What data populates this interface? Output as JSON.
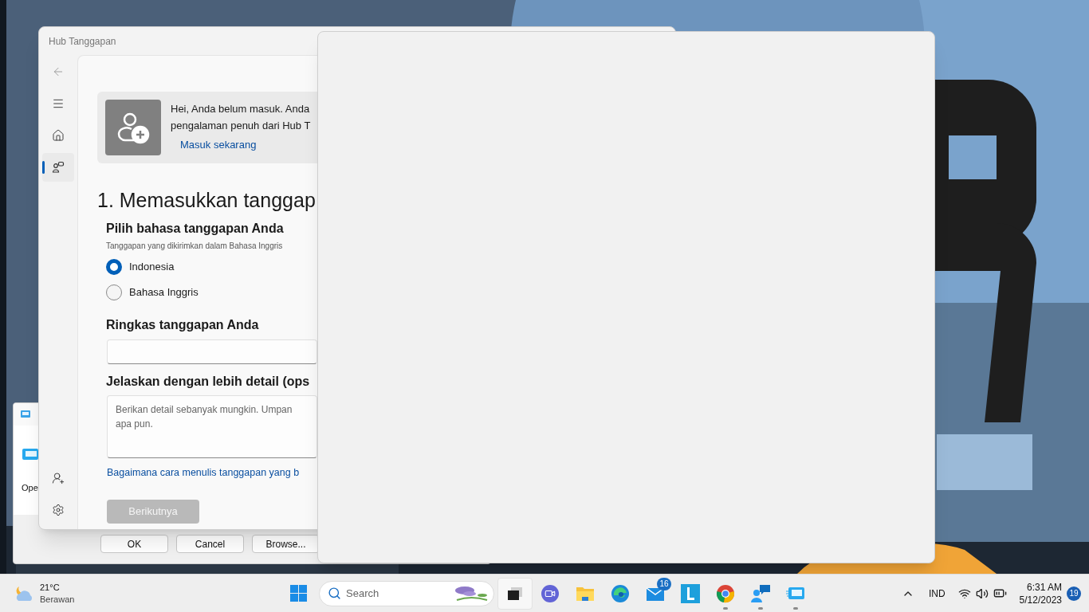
{
  "back_dialog": {
    "open_label": "Ope",
    "buttons": [
      "OK",
      "Cancel",
      "Browse..."
    ]
  },
  "feedback_window": {
    "title": "Hub Tanggapan",
    "nav_top": [
      {
        "kind": "back",
        "selected": false
      },
      {
        "kind": "menu",
        "selected": false
      },
      {
        "kind": "home",
        "selected": false
      },
      {
        "kind": "feedback",
        "selected": true
      }
    ],
    "nav_bottom": [
      {
        "kind": "add-user",
        "selected": false
      },
      {
        "kind": "settings",
        "selected": false
      }
    ],
    "sign_in_banner": {
      "lines": [
        "Hei, Anda belum masuk. Anda",
        "pengalaman penuh dari Hub T"
      ],
      "link": "Masuk sekarang"
    },
    "heading": "1. Memasukkan tanggap",
    "language": {
      "label": "Pilih bahasa tanggapan Anda",
      "note": "Tanggapan yang dikirimkan dalam Bahasa Inggris",
      "options": [
        {
          "label": "Indonesia",
          "selected": true
        },
        {
          "label": "Bahasa Inggris",
          "selected": false
        }
      ]
    },
    "summary": {
      "label": "Ringkas tanggapan Anda"
    },
    "details": {
      "label": "Jelaskan dengan lebih detail (ops",
      "placeholder": "Berikan detail sebanyak mungkin. Umpan\napa pun."
    },
    "help_link": "Bagaimana cara menulis tanggapan yang b",
    "next_button": {
      "label": "Berikutnya",
      "disabled": true
    }
  },
  "taskbar": {
    "weather": {
      "temperature": "21°C",
      "condition": "Berawan"
    },
    "search": {
      "placeholder": "Search"
    },
    "apps": [
      {
        "kind": "task-view",
        "running": false
      },
      {
        "kind": "video",
        "running": false
      },
      {
        "kind": "folder",
        "running": false
      },
      {
        "kind": "edge",
        "running": false
      },
      {
        "kind": "mail",
        "running": false,
        "badge": "16"
      },
      {
        "kind": "letter",
        "running": false
      },
      {
        "kind": "chrome",
        "running": true
      },
      {
        "kind": "chat",
        "running": true
      },
      {
        "kind": "screen",
        "running": true
      }
    ],
    "language": "IND",
    "time": "6:31 AM",
    "date": "5/12/2023",
    "notifications": "19"
  }
}
